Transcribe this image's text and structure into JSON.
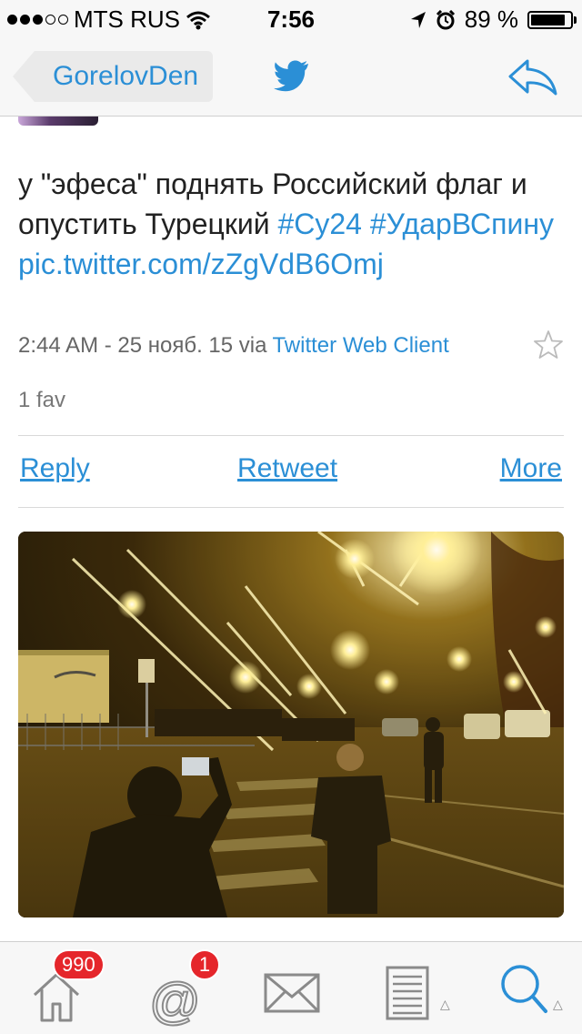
{
  "status_bar": {
    "carrier": "MTS RUS",
    "time": "7:56",
    "battery": "89 %",
    "battery_level": 0.89
  },
  "nav": {
    "back_label": "GorelovDen"
  },
  "tweet": {
    "text_plain": "у \"эфеса\" поднять Российский флаг и опустить Турецкий ",
    "hashtag1": "#Cy24",
    "hashtag2": "#УдарВСпину",
    "link": "pic.twitter.com/zZgVdB6Omj",
    "timestamp": "2:44 AM - 25 нояб. 15 via",
    "client": "Twitter Web Client",
    "favs": "1 fav"
  },
  "actions": {
    "reply": "Reply",
    "retweet": "Retweet",
    "more": "More"
  },
  "tabs": {
    "home_badge": "990",
    "mentions_badge": "1"
  },
  "colors": {
    "accent": "#2b8fd6",
    "badge": "#e5262b"
  }
}
